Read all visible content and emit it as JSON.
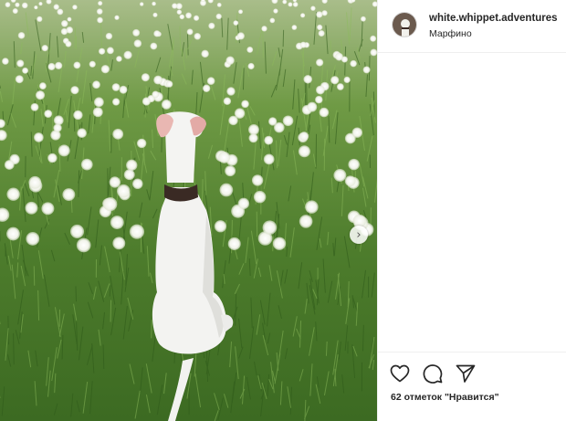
{
  "post": {
    "username": "white.whippet.adventures",
    "location": "Марфино",
    "likes_text": "62 отметок \"Нравится\""
  },
  "icons": {
    "avatar": "dog-avatar-icon",
    "next": "chevron-right-icon",
    "like": "heart-icon",
    "comment": "comment-icon",
    "share": "paper-plane-icon"
  },
  "colors": {
    "text": "#262626",
    "divider": "#efefef"
  }
}
